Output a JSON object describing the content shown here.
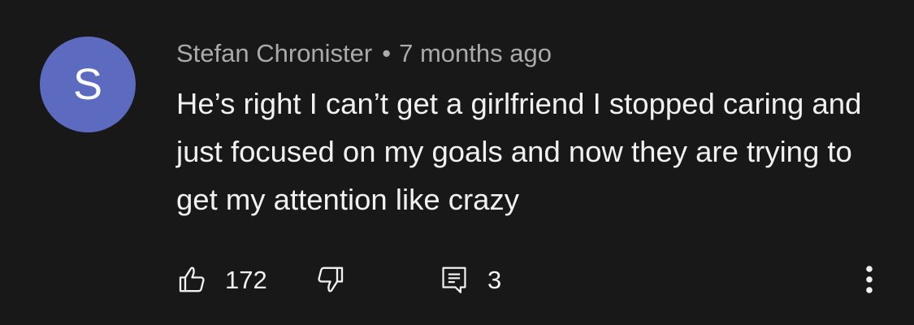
{
  "comment": {
    "avatar_letter": "S",
    "avatar_color": "#5c6bc0",
    "author": "Stefan Chronister",
    "separator": "•",
    "time": "7 months ago",
    "text": "He’s right I can’t get a girlfriend I stopped caring and just focused on my goals and now they are trying to get my attention like crazy",
    "likes": "172",
    "replies": "3"
  },
  "icons": {
    "like": "thumbs-up-icon",
    "dislike": "thumbs-down-icon",
    "reply": "comment-icon",
    "more": "more-vertical-icon"
  },
  "colors": {
    "background": "#181818",
    "text_primary": "#f1f1f1",
    "text_secondary": "#aaaaaa"
  }
}
